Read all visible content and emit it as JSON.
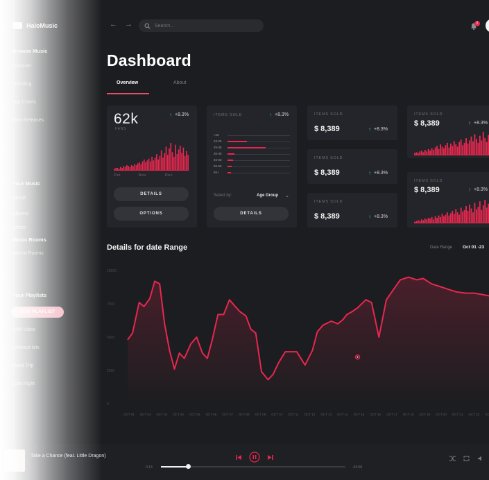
{
  "app": {
    "name": "HaloMusic"
  },
  "sidebar": {
    "sections": [
      {
        "heading": "Browse Music",
        "items": [
          "Discover",
          "Trending",
          "Top Charts",
          "New Releases"
        ]
      },
      {
        "heading": "Your Music",
        "items": [
          "Songs",
          "Albums",
          "Artists"
        ]
      },
      {
        "heading": "Music Rooms",
        "items": [
          "Joined Rooms"
        ]
      },
      {
        "heading": "Your Playlists",
        "items": [
          "Chill Vibes",
          "Workout Mix",
          "Road Trip",
          "Late Night"
        ]
      }
    ],
    "new_playlist_label": "NEW PLAYLIST"
  },
  "topbar": {
    "back_icon": "arrow-left-icon",
    "forward_icon": "arrow-right-icon",
    "search_placeholder": "Search...",
    "notification_count": "2"
  },
  "page": {
    "title": "Dashboard",
    "tabs": [
      {
        "label": "Overview",
        "active": true
      },
      {
        "label": "About",
        "active": false
      }
    ]
  },
  "fans_card": {
    "value": "62k",
    "label": "FANS",
    "delta": "+8.3%",
    "months": [
      "Oct",
      "Nov",
      "Dec"
    ],
    "bars": [
      2,
      3,
      3,
      2,
      4,
      3,
      5,
      4,
      6,
      5,
      4,
      6,
      5,
      7,
      6,
      8,
      9,
      7,
      10,
      12,
      9,
      11,
      13,
      10,
      15,
      11,
      14,
      18,
      12,
      16,
      22,
      14,
      19,
      26,
      17,
      24,
      30,
      20,
      15,
      28,
      18,
      23,
      27,
      19,
      25,
      16,
      21,
      17
    ],
    "details_label": "DETAILS",
    "options_label": "OPTIONS"
  },
  "age_card": {
    "label": "ITEMS SOLD",
    "delta": "+8.3%",
    "groups": [
      {
        "name": "<18",
        "value": 0.0
      },
      {
        "name": "18-25",
        "value": 0.28
      },
      {
        "name": "25-35",
        "value": 0.55
      },
      {
        "name": "35-45",
        "value": 0.1
      },
      {
        "name": "45-55",
        "value": 0.08
      },
      {
        "name": "55-65",
        "value": 0.06
      },
      {
        "name": "65+",
        "value": 0.05
      }
    ],
    "select_label": "Select by:",
    "select_value": "Age Group",
    "details_label": "DETAILS"
  },
  "items_cards": [
    {
      "label": "ITEMS SOLD",
      "value": "$ 8,389",
      "delta": "+8.3%"
    },
    {
      "label": "ITEMS SOLD",
      "value": "$ 8,389",
      "delta": "+8.3%"
    },
    {
      "label": "ITEMS SOLD",
      "value": "$ 8,389",
      "delta": "+8.3%"
    }
  ],
  "chart_cards": [
    {
      "label": "ITEMS SOLD",
      "value": "$ 8,389",
      "delta": "+8.3%",
      "bars": [
        3,
        4,
        3,
        5,
        6,
        4,
        7,
        5,
        8,
        6,
        9,
        7,
        10,
        12,
        8,
        14,
        11,
        9,
        13,
        16,
        10,
        15,
        12,
        18,
        14,
        11,
        17,
        20,
        13,
        16,
        22,
        15,
        19,
        24,
        18,
        27,
        21,
        16,
        25,
        19,
        30,
        22,
        17,
        26,
        20,
        14,
        23,
        18
      ]
    },
    {
      "label": "ITEMS SOLD",
      "value": "$ 8,389",
      "delta": "+8.3%",
      "bars": [
        2,
        3,
        4,
        3,
        5,
        4,
        6,
        5,
        7,
        6,
        8,
        5,
        9,
        7,
        10,
        8,
        12,
        9,
        11,
        14,
        10,
        13,
        16,
        12,
        18,
        14,
        11,
        20,
        15,
        17,
        22,
        16,
        24,
        19,
        14,
        26,
        18,
        21,
        28,
        17,
        23,
        30,
        20,
        25,
        22,
        18,
        27,
        21
      ]
    }
  ],
  "range_section": {
    "title": "Details for date Range",
    "range_label": "Date Range",
    "range_value": "Oct 01 -23"
  },
  "chart_data": {
    "type": "area",
    "title": "Details for date Range",
    "ylabels": [
      "10000",
      "7500",
      "5000",
      "2500",
      "0"
    ],
    "categories": [
      "OCT 01",
      "OCT 02",
      "OCT 03",
      "OCT 04",
      "OCT 05",
      "OCT 06",
      "OCT 07",
      "OCT 08",
      "OCT 09",
      "OCT 10",
      "OCT 11",
      "OCT 12",
      "OCT 13",
      "OCT 14",
      "OCT 15",
      "OCT 16",
      "OCT 17",
      "OCT 18",
      "OCT 19",
      "OCT 20",
      "OCT 21",
      "OCT 22",
      "OCT 23"
    ],
    "x": [
      0,
      0.3,
      0.7,
      1.0,
      1.35,
      1.65,
      1.95,
      2.25,
      2.55,
      2.85,
      3.15,
      3.45,
      3.85,
      4.2,
      4.55,
      4.85,
      5.15,
      5.5,
      5.85,
      6.2,
      6.55,
      6.85,
      7.2,
      7.5,
      7.8,
      8.15,
      8.55,
      8.85,
      9.2,
      9.6,
      10.3,
      10.55,
      10.8,
      11.25,
      11.55,
      11.9,
      12.4,
      12.8,
      13.1,
      13.35,
      13.65,
      14.0,
      14.5,
      14.85,
      15.3,
      15.75,
      16.2,
      16.6,
      17.1,
      17.6,
      18.0,
      18.5,
      19.0,
      19.5,
      20.0,
      20.6,
      21.1,
      21.6,
      22.0
    ],
    "y": [
      4800,
      5300,
      7600,
      7300,
      7900,
      9200,
      9000,
      6000,
      4000,
      2600,
      3800,
      3400,
      4500,
      5000,
      3800,
      3400,
      4800,
      6700,
      6700,
      7800,
      7300,
      6900,
      6600,
      5600,
      5300,
      2400,
      1800,
      2200,
      3100,
      3900,
      3900,
      3400,
      2900,
      4000,
      5400,
      5900,
      6200,
      6000,
      6300,
      6700,
      6900,
      7200,
      7800,
      7600,
      5000,
      7800,
      8600,
      9300,
      9500,
      9300,
      9400,
      9000,
      8800,
      8600,
      8400,
      8300,
      8300,
      8200,
      8100
    ],
    "marker": {
      "x": 14.0,
      "y": 3500
    },
    "ylim": [
      0,
      10000
    ],
    "series_color": "#e8274f"
  },
  "player": {
    "song": "Take a Chance (feat. Little Dragon)",
    "elapsed": "0:13",
    "total": "-03:58",
    "progress": 0.15
  }
}
